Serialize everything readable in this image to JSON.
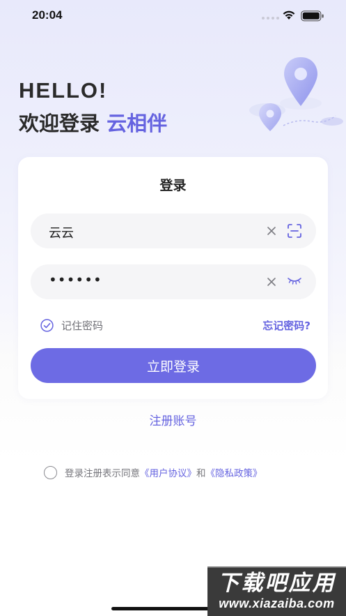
{
  "status_bar": {
    "time": "20:04"
  },
  "header": {
    "greeting": "HELLO!",
    "welcome_prefix": "欢迎登录 ",
    "brand_name": "云相伴"
  },
  "login_card": {
    "title": "登录",
    "username": {
      "value": "云云",
      "clear_icon": "close-icon",
      "scan_icon": "scan-icon"
    },
    "password": {
      "masked_value": "••••••",
      "clear_icon": "close-icon",
      "toggle_icon": "eye-closed-icon"
    },
    "remember_label": "记住密码",
    "remember_checked": true,
    "forgot_label": "忘记密码?",
    "submit_label": "立即登录"
  },
  "register_label": "注册账号",
  "agreement": {
    "prefix": "登录注册表示同意",
    "user_agreement": "《用户协议》",
    "conjunction": "和",
    "privacy_policy": "《隐私政策》",
    "checked": false
  },
  "watermark": {
    "title": "下载吧应用",
    "url": "www.xiazaiba.com"
  },
  "colors": {
    "accent": "#6563e0",
    "button": "#6d6be4",
    "field_bg": "#f5f5f7",
    "text_primary": "#222222",
    "text_muted": "#77777d"
  }
}
